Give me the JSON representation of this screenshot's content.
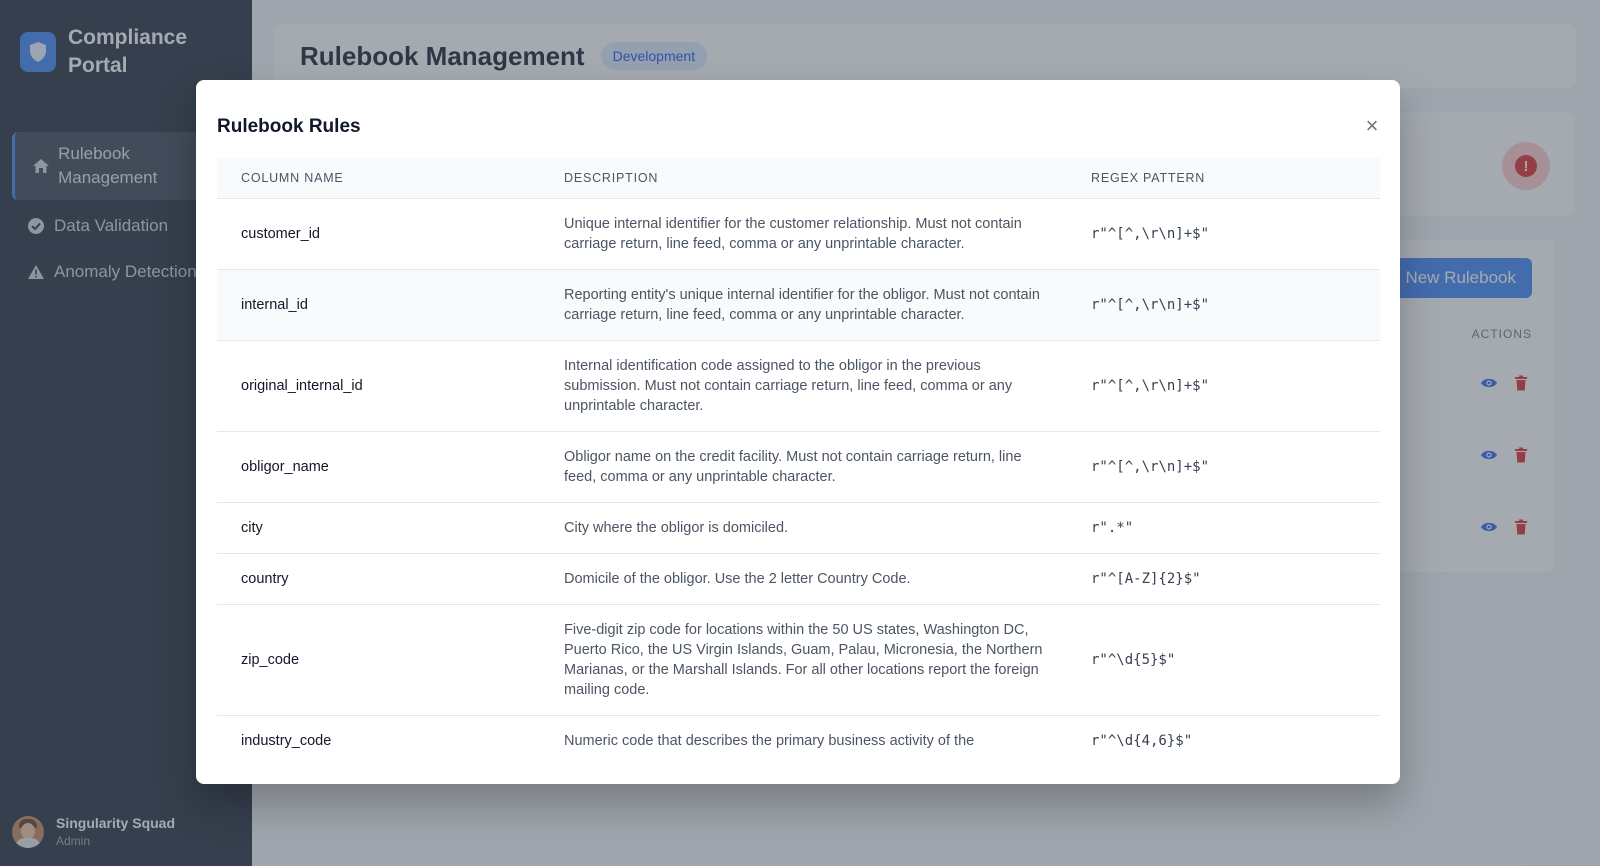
{
  "sidebar": {
    "brand": "Compliance Portal",
    "nav": [
      {
        "label": "Rulebook Management",
        "icon": "home-icon",
        "active": true
      },
      {
        "label": "Data Validation",
        "icon": "check-circle-icon",
        "active": false
      },
      {
        "label": "Anomaly Detection",
        "icon": "warning-icon",
        "active": false
      }
    ],
    "user": {
      "name": "Singularity Squad",
      "role": "Admin"
    }
  },
  "header": {
    "title": "Rulebook Management",
    "env_badge": "Development"
  },
  "list": {
    "new_button": "New Rulebook",
    "actions_header": "ACTIONS"
  },
  "modal": {
    "title": "Rulebook Rules",
    "close_label": "×",
    "columns": [
      "COLUMN NAME",
      "DESCRIPTION",
      "REGEX PATTERN"
    ],
    "rows": [
      {
        "name": "customer_id",
        "description": "Unique internal identifier for the customer relationship. Must not contain carriage return, line feed, comma or any unprintable character.",
        "regex": "r\"^[^,\\r\\n]+$\""
      },
      {
        "name": "internal_id",
        "description": "Reporting entity's unique internal identifier for the obligor. Must not contain carriage return, line feed, comma or any unprintable character.",
        "regex": "r\"^[^,\\r\\n]+$\""
      },
      {
        "name": "original_internal_id",
        "description": "Internal identification code assigned to the obligor in the previous submission. Must not contain carriage return, line feed, comma or any unprintable character.",
        "regex": "r\"^[^,\\r\\n]+$\""
      },
      {
        "name": "obligor_name",
        "description": "Obligor name on the credit facility. Must not contain carriage return, line feed, comma or any unprintable character.",
        "regex": "r\"^[^,\\r\\n]+$\""
      },
      {
        "name": "city",
        "description": "City where the obligor is domiciled.",
        "regex": "r\".*\""
      },
      {
        "name": "country",
        "description": "Domicile of the obligor. Use the 2 letter Country Code.",
        "regex": "r\"^[A-Z]{2}$\""
      },
      {
        "name": "zip_code",
        "description": "Five-digit zip code for locations within the 50 US states, Washington DC, Puerto Rico, the US Virgin Islands, Guam, Palau, Micronesia, the Northern Marianas, or the Marshall Islands. For all other locations report the foreign mailing code.",
        "regex": "r\"^\\d{5}$\""
      },
      {
        "name": "industry_code",
        "description": "Numeric code that describes the primary business activity of the",
        "regex": "r\"^\\d{4,6}$\""
      }
    ]
  },
  "colors": {
    "sidebar_bg": "#1f2937",
    "accent": "#3b82f6",
    "danger": "#dc2626",
    "badge_bg": "#dbeafe"
  }
}
